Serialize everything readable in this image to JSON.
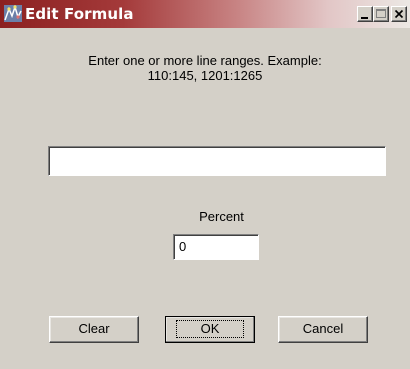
{
  "window": {
    "title": "Edit Formula",
    "app_icon": "app-logo-icon",
    "controls": [
      "minimize-icon",
      "maximize-icon",
      "close-icon"
    ]
  },
  "instructions": {
    "line1": "Enter  one or more line  ranges. Example:",
    "line2": "110:145, 1201:1265"
  },
  "ranges_input": {
    "value": ""
  },
  "percent": {
    "label": "Percent",
    "value": "0"
  },
  "buttons": {
    "clear": "Clear",
    "ok": "OK",
    "cancel": "Cancel"
  }
}
